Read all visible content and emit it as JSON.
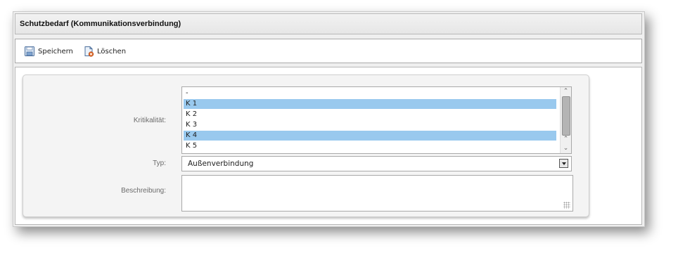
{
  "window": {
    "title": "Schutzbedarf (Kommunikationsverbindung)"
  },
  "toolbar": {
    "save_label": "Speichern",
    "delete_label": "Löschen",
    "save_icon": "save-disk-icon",
    "delete_icon": "delete-document-icon"
  },
  "form": {
    "kritikalitaet": {
      "label": "Kritikalität:",
      "options": [
        {
          "text": "-",
          "selected": false
        },
        {
          "text": "K 1",
          "selected": true
        },
        {
          "text": "K 2",
          "selected": false
        },
        {
          "text": "K 3",
          "selected": false
        },
        {
          "text": "K 4",
          "selected": true
        },
        {
          "text": "K 5",
          "selected": false
        }
      ]
    },
    "typ": {
      "label": "Typ:",
      "value": "Außenverbindung"
    },
    "beschreibung": {
      "label": "Beschreibung:",
      "value": ""
    }
  },
  "colors": {
    "selection": "#99c9ee",
    "label_text": "#6b6b6b"
  }
}
